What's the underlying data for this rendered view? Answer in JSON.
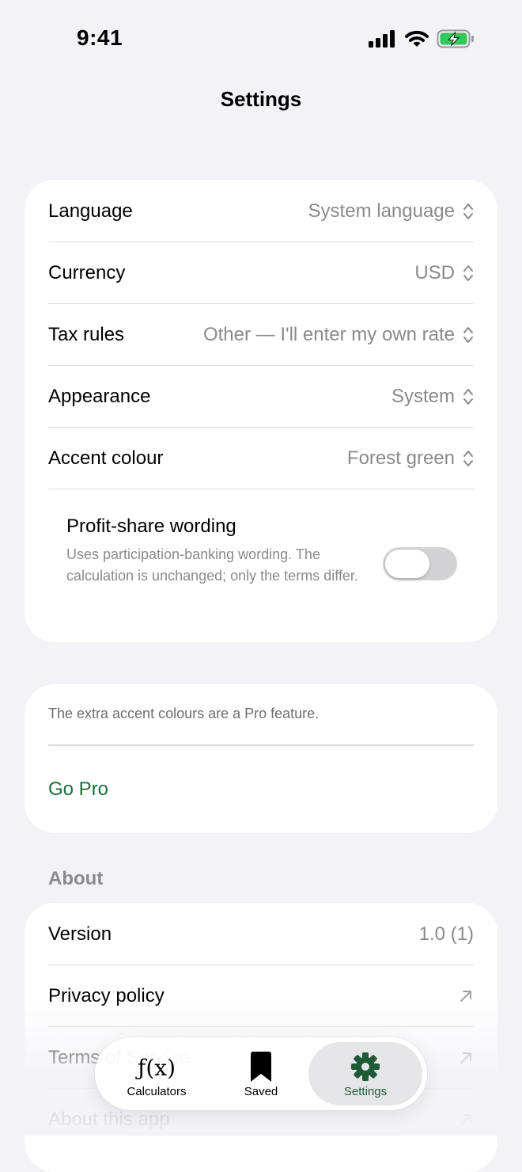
{
  "status_bar": {
    "time": "9:41"
  },
  "header": {
    "title": "Settings"
  },
  "preferences": {
    "rows": [
      {
        "label": "Language",
        "value": "System language"
      },
      {
        "label": "Currency",
        "value": "USD"
      },
      {
        "label": "Tax rules",
        "value": "Other — I'll enter my own rate"
      },
      {
        "label": "Appearance",
        "value": "System"
      },
      {
        "label": "Accent colour",
        "value": "Forest green"
      }
    ],
    "profit_share": {
      "title": "Profit-share wording",
      "description": "Uses participation-banking wording. The calculation is unchanged; only the terms differ.",
      "enabled": false
    }
  },
  "pro": {
    "note": "The extra accent colours are a Pro feature.",
    "cta": "Go Pro"
  },
  "about": {
    "header": "About",
    "version_label": "Version",
    "version_value": "1.0 (1)",
    "privacy": "Privacy policy",
    "terms": "Terms of Service",
    "about_app": "About this app"
  },
  "tabbar": {
    "items": [
      {
        "label": "Calculators",
        "icon": "function-icon"
      },
      {
        "label": "Saved",
        "icon": "bookmark-icon"
      },
      {
        "label": "Settings",
        "icon": "gear-icon",
        "selected": true
      }
    ]
  },
  "colors": {
    "accent": "#1e6b3e",
    "background": "#f2f2f7",
    "card": "#ffffff",
    "secondary_text": "#8a8a8e",
    "battery_charging": "#34c759"
  }
}
